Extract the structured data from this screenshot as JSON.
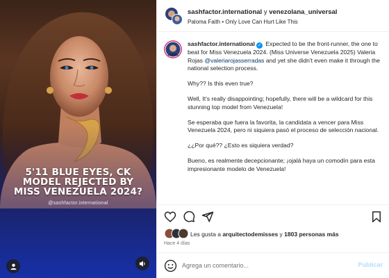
{
  "header": {
    "author_primary": "sashfactor.international",
    "joiner": "y",
    "author_secondary": "venezolana_universal",
    "audio": "Paloma Faith • Only Love Can Hurt Like This",
    "more_icon": "more-options-icon"
  },
  "media": {
    "headline": "5'11 BLUE EYES, CK MODEL REJECTED BY MISS VENEZUELA 2024?",
    "credit": "@sashfactor.international",
    "user_tag_icon": "user-tag-icon",
    "audio_icon": "speaker-icon"
  },
  "caption": {
    "username": "sashfactor.international",
    "verified_glyph": "✓",
    "intro_1": "Expected to be the front-runner, the one to beat for Miss Venezuela 2024. (Miss Universe Venezuela 2025) Valeria Rojas",
    "mention": "@valeriarojasserradas",
    "intro_2": "and yet she didn't even make it through the national selection process.",
    "p2": "Why?? Is this even true?",
    "p3": "Well, It's really disappointing; hopefully, there will be a wildcard for this stunning top model from Venezuela!",
    "p4": "Se esperaba que fuera la favorita, la candidata a vencer para Miss Venezuela 2024, pero ni siquiera pasó el proceso de selección nacional.",
    "p5": "¿¿Por qué?? ¿Esto es siquiera verdad?",
    "p6": "Bueno, es realmente decepcionante; ¡ojalá haya un comodín para esta impresionante modelo de Venezuela!"
  },
  "actions": {
    "icons": [
      "heart-icon",
      "comment-icon",
      "share-icon",
      "bookmark-icon"
    ]
  },
  "likes": {
    "prefix": "Les gusta a",
    "user": "arquitectodemisses",
    "middle": "y",
    "count": "1803 personas más"
  },
  "date": "Hace 4 días",
  "comment": {
    "placeholder": "Agrega un comentario...",
    "publish": "Publicar"
  },
  "colors": {
    "accent": "#0095f6",
    "publish_disabled": "#b2dffc",
    "mention": "#00376b",
    "muted": "#737373"
  }
}
